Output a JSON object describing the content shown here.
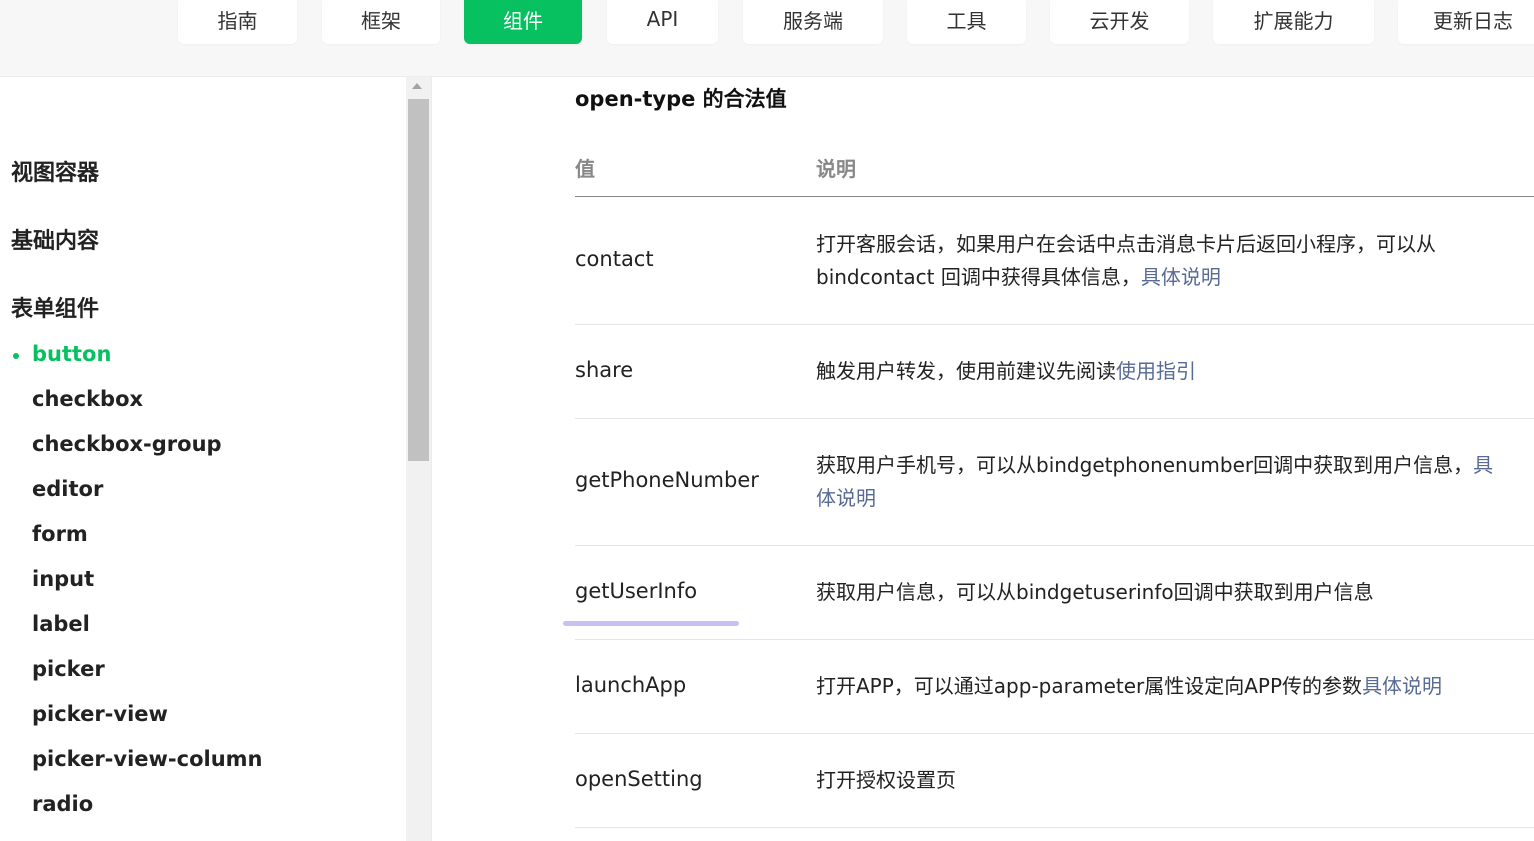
{
  "nav": {
    "tabs": [
      {
        "label": "指南"
      },
      {
        "label": "框架"
      },
      {
        "label": "组件"
      },
      {
        "label": "API"
      },
      {
        "label": "服务端"
      },
      {
        "label": "工具"
      },
      {
        "label": "云开发"
      },
      {
        "label": "扩展能力"
      },
      {
        "label": "更新日志"
      }
    ],
    "active_tab": "组件"
  },
  "sidebar": {
    "categories": [
      "视图容器",
      "基础内容",
      "表单组件"
    ],
    "items": [
      "button",
      "checkbox",
      "checkbox-group",
      "editor",
      "form",
      "input",
      "label",
      "picker",
      "picker-view",
      "picker-view-column",
      "radio"
    ],
    "active_item": "button"
  },
  "content": {
    "section_title": "open-type 的合法值",
    "table": {
      "headers": {
        "value": "值",
        "desc": "说明"
      },
      "rows": [
        {
          "value": "contact",
          "desc_text": "打开客服会话，如果用户在会话中点击消息卡片后返回小程序，可以从bindcontact 回调中获得具体信息，",
          "desc_link": "具体说明"
        },
        {
          "value": "share",
          "desc_text": "触发用户转发，使用前建议先阅读",
          "desc_link": "使用指引"
        },
        {
          "value": "getPhoneNumber",
          "desc_text": "获取用户手机号，可以从bindgetphonenumber回调中获取到用户信息，",
          "desc_link": "具体说明"
        },
        {
          "value": "getUserInfo",
          "desc_text": "获取用户信息，可以从bindgetuserinfo回调中获取到用户信息",
          "desc_link": ""
        },
        {
          "value": "launchApp",
          "desc_text": "打开APP，可以通过app-parameter属性设定向APP传的参数",
          "desc_link": "具体说明"
        },
        {
          "value": "openSetting",
          "desc_text": "打开授权设置页",
          "desc_link": ""
        }
      ]
    }
  },
  "colors": {
    "accent": "#07c160",
    "link": "#576b95",
    "highlight": "#c8c0f3"
  }
}
